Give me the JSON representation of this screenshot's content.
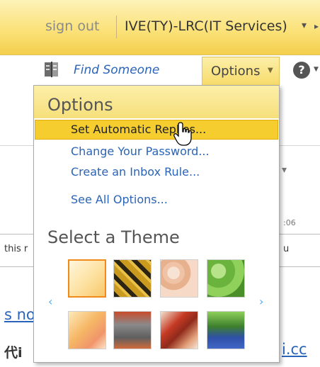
{
  "header": {
    "sign_out": "sign out",
    "user": "IVE(TY)-LRC(IT Services)"
  },
  "toolbar": {
    "find_someone": "Find Someone",
    "options": "Options"
  },
  "menu": {
    "title": "Options",
    "items": [
      "Set Automatic Replies...",
      "Change Your Password...",
      "Create an Inbox Rule...",
      "See All Options..."
    ],
    "highlighted_index": 0,
    "theme_title": "Select a Theme",
    "themes": [
      {
        "icon": "sunrise-theme",
        "selected": true
      },
      {
        "icon": "stripes-theme",
        "selected": false
      },
      {
        "icon": "pastel-swirl-theme",
        "selected": false
      },
      {
        "icon": "green-leaves-theme",
        "selected": false
      },
      {
        "icon": "orange-glow-theme",
        "selected": false
      },
      {
        "icon": "robot-theme",
        "selected": false
      },
      {
        "icon": "red-leaves-theme",
        "selected": false
      },
      {
        "icon": "monster-theme",
        "selected": false
      }
    ]
  },
  "background": {
    "time_fragment": ":06",
    "text_fragment": "this r",
    "u_fragment": "u",
    "link_fragment_left": "s no",
    "cjk_fragment": "代ⅰ",
    "link_fragment_right": "i.cc"
  },
  "colors": {
    "accent_yellow": "#f6cd2f",
    "link_blue": "#2a64b8",
    "selected_theme_border": "#f08a1c"
  }
}
